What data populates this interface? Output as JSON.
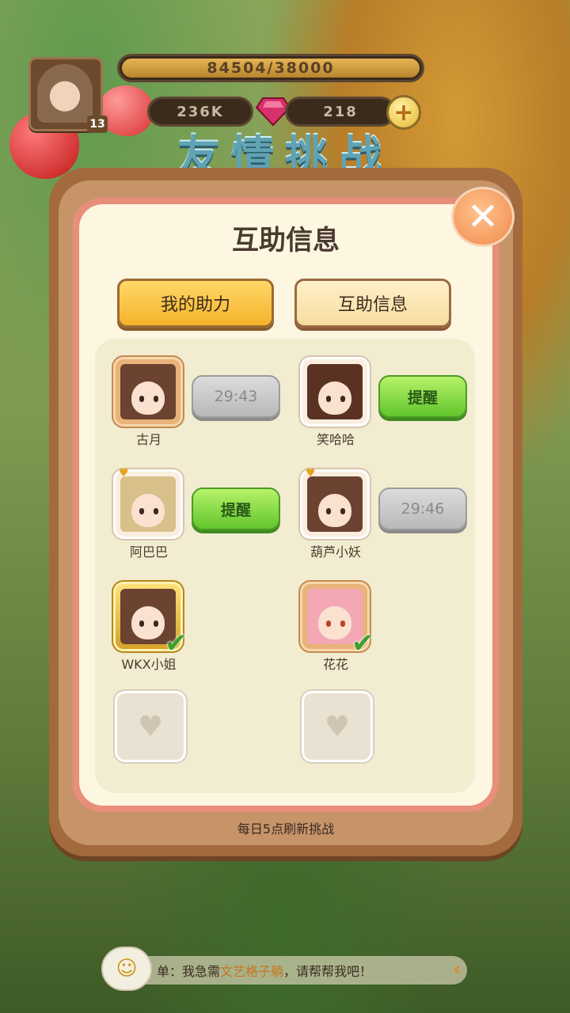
{
  "hud": {
    "xp_text": "84504/38000",
    "xp_fill_fraction": 1.0,
    "coins": "236K",
    "gems": "218",
    "level": "13",
    "plus_icon": "plus-icon",
    "gem_icon": "gem-icon"
  },
  "banner_title": "友情挑战",
  "dialog": {
    "title": "互助信息",
    "close_icon": "close-icon",
    "tabs": [
      {
        "label": "我的助力",
        "active": true
      },
      {
        "label": "互助信息",
        "active": false
      }
    ],
    "friends": [
      {
        "name": "古月",
        "action": "timer",
        "action_text": "29:43",
        "frame": "bread"
      },
      {
        "name": "笑哈哈",
        "action": "remind",
        "action_text": "提醒",
        "frame": "plain"
      },
      {
        "name": "阿巴巴",
        "action": "remind",
        "action_text": "提醒",
        "frame": "plain"
      },
      {
        "name": "葫芦小妖",
        "action": "timer",
        "action_text": "29:46",
        "frame": "plain"
      },
      {
        "name": "WKX小姐",
        "action": "done",
        "action_text": "",
        "frame": "gold"
      },
      {
        "name": "花花",
        "action": "done",
        "action_text": "",
        "frame": "bread"
      }
    ],
    "empty_slot_icon": "heart-icon",
    "footer": "每日5点刷新挑战"
  },
  "chat": {
    "prefix": "单：我急需",
    "highlight": "文艺格子躺",
    "suffix": "，请帮帮我吧！",
    "icon": "chat-bubble-icon"
  },
  "colors": {
    "accent": "#f5b22a",
    "remind": "#62c52c",
    "timer": "#b8b8b8",
    "panel_border": "#e88e7b"
  }
}
